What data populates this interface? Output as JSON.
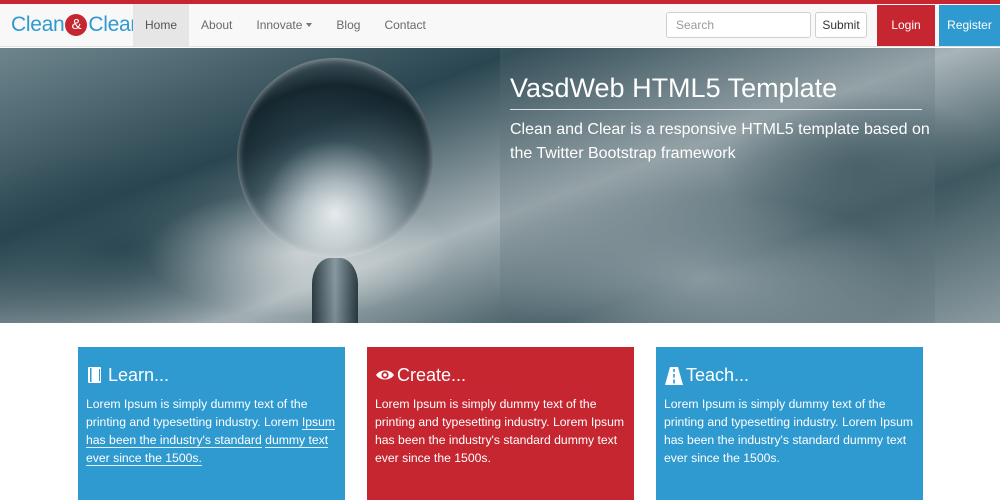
{
  "brand": {
    "part1": "Clean",
    "amp": "&",
    "part2": "Clear"
  },
  "nav": {
    "items": [
      {
        "label": "Home"
      },
      {
        "label": "About"
      },
      {
        "label": "Innovate"
      },
      {
        "label": "Blog"
      },
      {
        "label": "Contact"
      }
    ],
    "active": "Home"
  },
  "search": {
    "placeholder": "Search",
    "submit_label": "Submit"
  },
  "auth": {
    "login_label": "Login",
    "register_label": "Register"
  },
  "hero": {
    "title": "VasdWeb HTML5 Template",
    "subtitle": "Clean and Clear is a responsive HTML5 template based on the Twitter Bootstrap framework"
  },
  "cards": [
    {
      "icon": "book-icon",
      "title": "Learn...",
      "text": "Lorem Ipsum is simply dummy text of the printing and typesetting industry. Lorem Ipsum has been the industry's standard dummy text ever since the 1500s.",
      "color": "#2e9ad0"
    },
    {
      "icon": "eye-icon",
      "title": "Create...",
      "text": "Lorem Ipsum is simply dummy text of the printing and typesetting industry. Lorem Ipsum has been the industry's standard dummy text ever since the 1500s.",
      "color": "#c62630"
    },
    {
      "icon": "road-icon",
      "title": "Teach...",
      "text": "Lorem Ipsum is simply dummy text of the printing and typesetting industry. Lorem Ipsum has been the industry's standard dummy text ever since the 1500s.",
      "color": "#2e9ad0"
    }
  ],
  "colors": {
    "accent_red": "#c62630",
    "accent_blue": "#2e9ad0"
  }
}
